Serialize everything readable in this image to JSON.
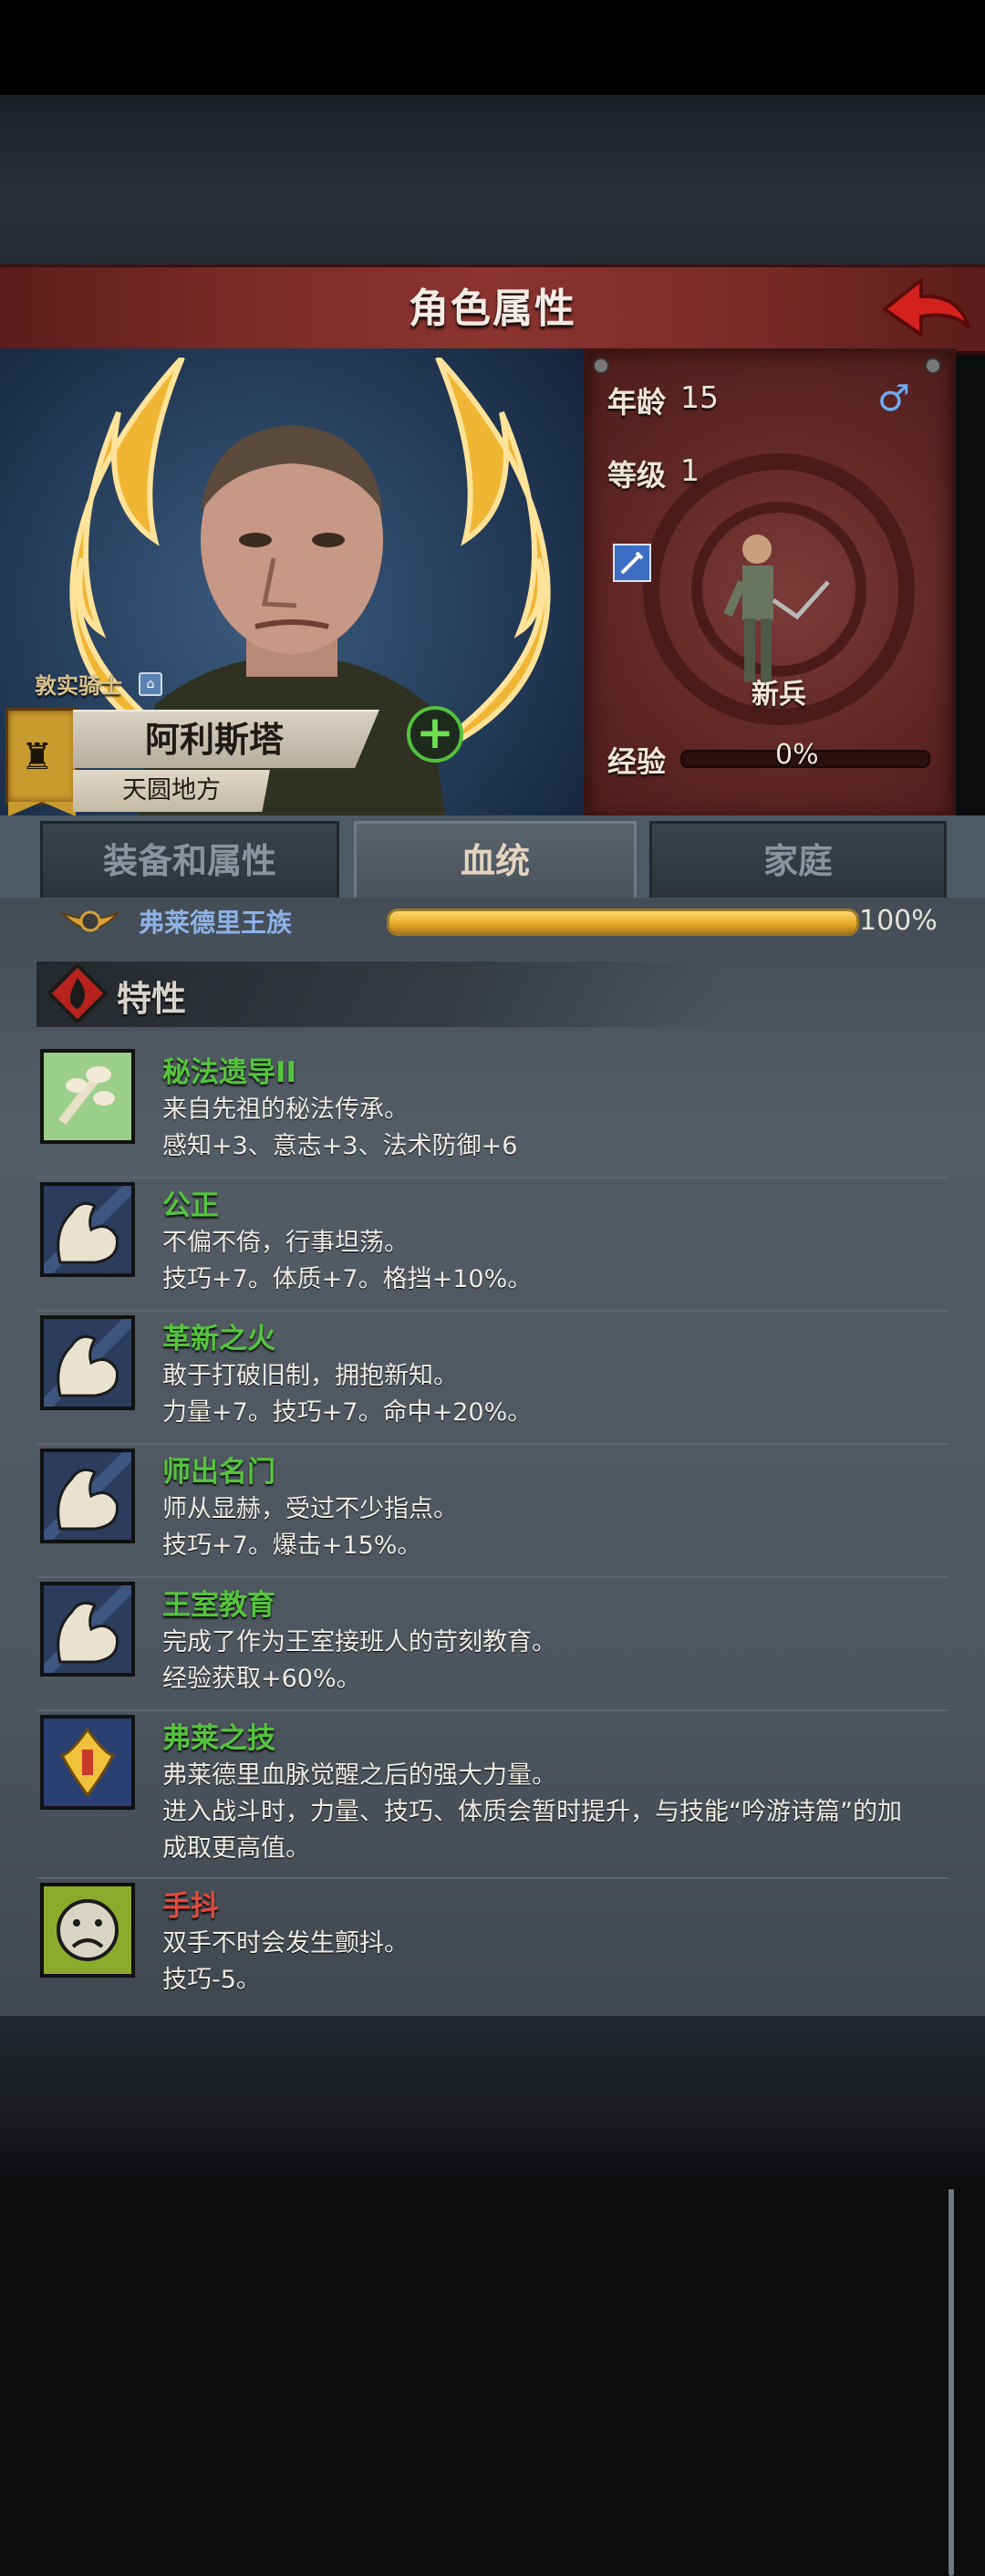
{
  "header": {
    "title": "角色属性"
  },
  "character": {
    "title_label": "敦实骑士",
    "name": "阿利斯塔",
    "region": "天圆地方"
  },
  "stats": {
    "age_label": "年龄",
    "age_value": "15",
    "level_label": "等级",
    "level_value": "1",
    "class_label": "新兵",
    "exp_label": "经验",
    "exp_value": "0%",
    "exp_progress": 0.0,
    "gender": "male"
  },
  "tabs": [
    {
      "label": "装备和属性",
      "active": false
    },
    {
      "label": "血统",
      "active": true
    },
    {
      "label": "家庭",
      "active": false
    }
  ],
  "bloodline": {
    "name": "弗莱德里王族",
    "percent": "100%",
    "progress": 1.0
  },
  "traits_section": {
    "title": "特性"
  },
  "traits": [
    {
      "name": "秘法遗导II",
      "icon": "leaf-hand-icon",
      "negative": false,
      "lines": [
        "来自先祖的秘法传承。",
        "感知+3、意志+3、法术防御+6"
      ]
    },
    {
      "name": "公正",
      "icon": "flexed-arm-icon",
      "negative": false,
      "lines": [
        "不偏不倚，行事坦荡。",
        "技巧+7。体质+7。格挡+10%。"
      ]
    },
    {
      "name": "革新之火",
      "icon": "flexed-arm-icon",
      "negative": false,
      "lines": [
        "敢于打破旧制，拥抱新知。",
        "力量+7。技巧+7。命中+20%。"
      ]
    },
    {
      "name": "师出名门",
      "icon": "flexed-arm-icon",
      "negative": false,
      "lines": [
        "师从显赫，受过不少指点。",
        "技巧+7。爆击+15%。"
      ]
    },
    {
      "name": "王室教育",
      "icon": "flexed-arm-icon",
      "negative": false,
      "lines": [
        "完成了作为王室接班人的苛刻教育。",
        "经验获取+60%。"
      ]
    },
    {
      "name": "弗莱之技",
      "icon": "golden-crest-icon",
      "negative": false,
      "lines": [
        "弗莱德里血脉觉醒之后的强大力量。",
        "进入战斗时，力量、技巧、体质会暂时提升，与技能“吟游诗篇”的加",
        "成取更高值。"
      ]
    },
    {
      "name": "手抖",
      "icon": "sad-face-icon",
      "negative": true,
      "lines": [
        "双手不时会发生颤抖。",
        "技巧-5。"
      ]
    }
  ],
  "colors": {
    "positive_trait": "#55c43d",
    "negative_trait": "#e34a3d",
    "bloodline_gold": "#e4a82a",
    "header_red": "#7a2b27"
  }
}
